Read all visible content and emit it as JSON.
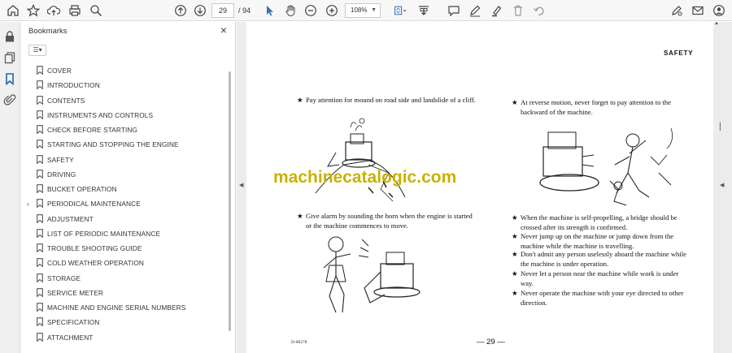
{
  "toolbar": {
    "page_current": "29",
    "page_total": "/ 94",
    "zoom": "108%"
  },
  "panel": {
    "title": "Bookmarks",
    "bookmarks": [
      {
        "label": "COVER",
        "expandable": false
      },
      {
        "label": "INTRODUCTION",
        "expandable": false
      },
      {
        "label": "CONTENTS",
        "expandable": false
      },
      {
        "label": "INSTRUMENTS AND CONTROLS",
        "expandable": false
      },
      {
        "label": "CHECK BEFORE STARTING",
        "expandable": false
      },
      {
        "label": "STARTING AND STOPPING THE ENGINE",
        "expandable": false
      },
      {
        "label": "SAFETY",
        "expandable": false
      },
      {
        "label": "DRIVING",
        "expandable": false
      },
      {
        "label": "BUCKET OPERATION",
        "expandable": false
      },
      {
        "label": "PERIODICAL MAINTENANCE",
        "expandable": true
      },
      {
        "label": "ADJUSTMENT",
        "expandable": false
      },
      {
        "label": "LIST OF PERIODIC MAINTENANCE",
        "expandable": false
      },
      {
        "label": "TROUBLE SHOOTING GUIDE",
        "expandable": false
      },
      {
        "label": "COLD WEATHER OPERATION",
        "expandable": false
      },
      {
        "label": "STORAGE",
        "expandable": false
      },
      {
        "label": "SERVICE METER",
        "expandable": false
      },
      {
        "label": "MACHINE AND ENGINE SERIAL NUMBERS",
        "expandable": false
      },
      {
        "label": "SPECIFICATION",
        "expandable": false
      },
      {
        "label": "ATTACHMENT",
        "expandable": false
      }
    ]
  },
  "document": {
    "header": "SAFETY",
    "watermark": "machinecatalogic.com",
    "page_number": "— 29 —",
    "code": "D-00278",
    "left_items": [
      "Pay attention for mound on road side and landslide of a cliff.",
      "Give alarm by sounding the horn when the engine is started or the machine commences to move."
    ],
    "right_items": [
      "At reverse motion, never forget to pay attention to the backward of the machine.",
      "When the machine is self-propelling, a bridge should be crossed after its strength is confirmed.",
      "Never jump up on the machine or jump down from the machine while the machine is travelling.",
      "Don't admit any person uselessly aboard the machine while the machine is under operation.",
      "Never let a person near the machine while work is under way.",
      "Never operate the machine with your eye directed to other direction."
    ],
    "star": "★"
  }
}
